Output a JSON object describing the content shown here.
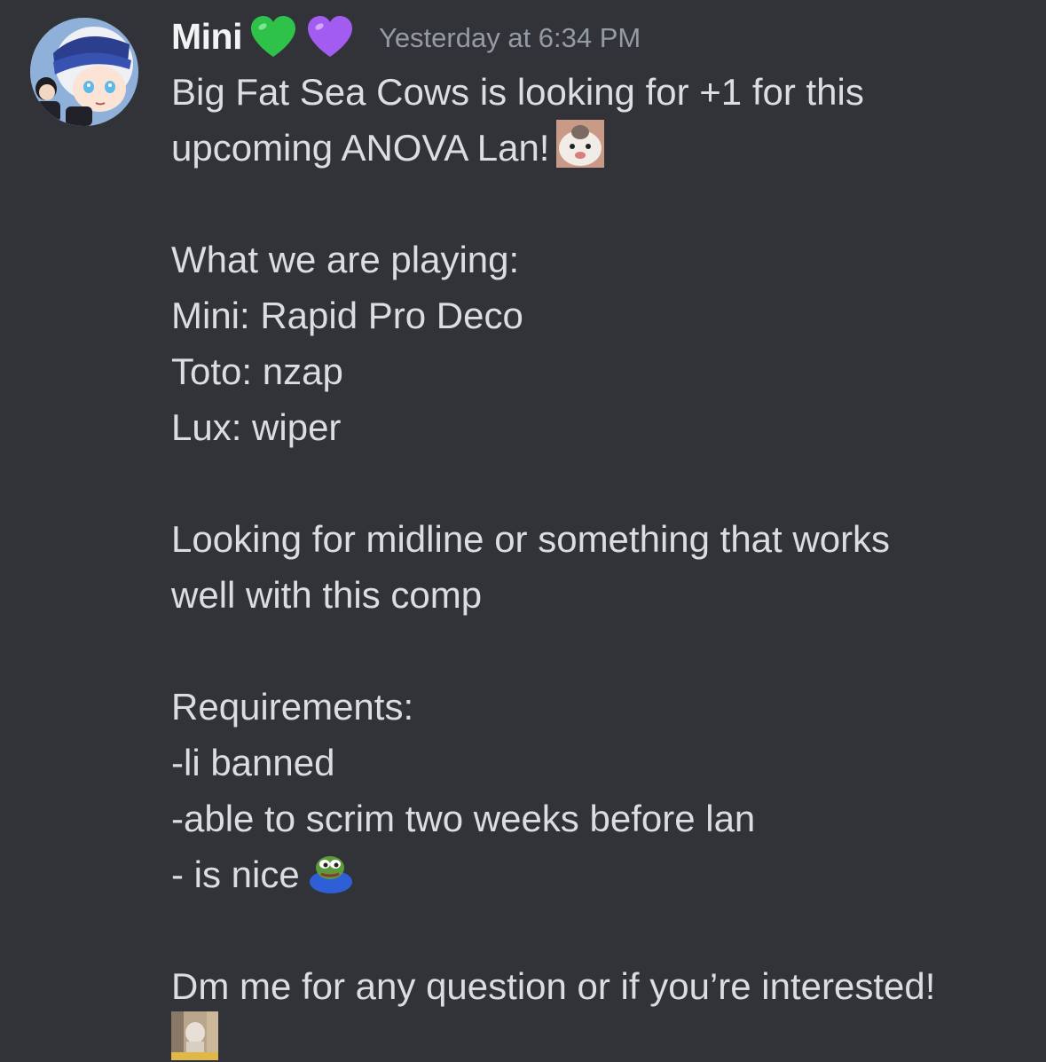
{
  "message": {
    "author": "Mini",
    "badges": [
      "green-heart-icon",
      "purple-heart-icon"
    ],
    "timestamp": "Yesterday at 6:34 PM",
    "colors": {
      "background": "#313338",
      "username": "#f2f3f5",
      "timestamp": "#949ba4",
      "text": "#dbdee1",
      "green_heart": "#2fc24a",
      "purple_heart": "#a35cf0"
    },
    "lines": [
      "Big Fat Sea Cows is looking for +1 for this",
      "upcoming ANOVA Lan!",
      "",
      "What we are playing:",
      "Mini: Rapid Pro Deco",
      "Toto: nzap",
      "Lux: wiper",
      "",
      "Looking for midline or something that works",
      "well with this comp",
      "",
      "Requirements:",
      "-li banned",
      "-able to scrim two weeks before lan",
      "- is nice",
      "",
      "Dm me for any question or if you’re interested!"
    ],
    "emojis": {
      "after_line_2": "cat-emoji-icon",
      "after_line_15": "pepe-frog-emoji-icon",
      "after_message": "blurry-cat-emoji-icon"
    }
  }
}
